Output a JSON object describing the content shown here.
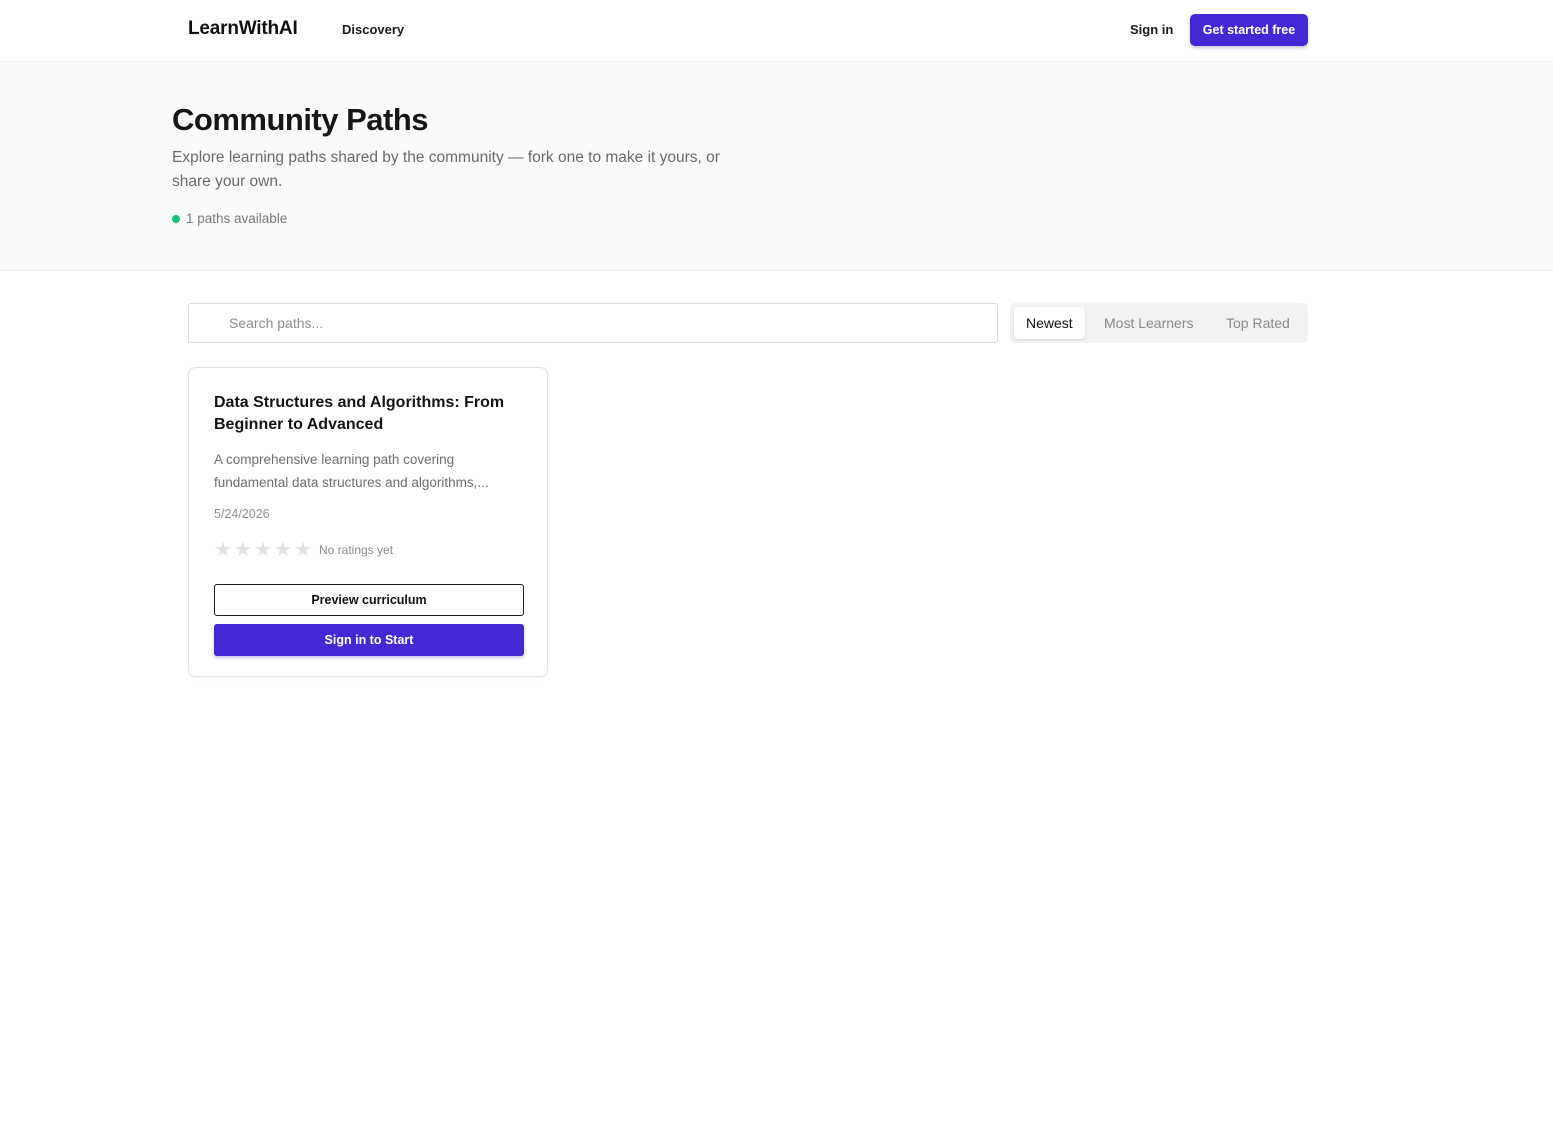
{
  "nav": {
    "brand": "LearnWithAI",
    "links": [
      "Discovery"
    ],
    "signin_label": "Sign in",
    "cta_label": "Get started free"
  },
  "hero": {
    "title": "Community Paths",
    "subtitle": "Explore learning paths shared by the community — fork one to make it yours, or share your own.",
    "status_text": "1 paths available",
    "status_color": "#16c27a"
  },
  "search": {
    "placeholder": "Search paths...",
    "value": ""
  },
  "sort": {
    "options": [
      "Newest",
      "Most Learners",
      "Top Rated"
    ],
    "selected": "Newest"
  },
  "paths": [
    {
      "title": "Data Structures and Algorithms: From Beginner to Advanced",
      "description": "A comprehensive learning path covering fundamental data structures and algorithms,...",
      "date": "5/24/2026",
      "rating": 0,
      "rating_text": "No ratings yet",
      "preview_label": "Preview curriculum",
      "start_label": "Sign in to Start"
    }
  ],
  "colors": {
    "accent": "#4527d6"
  }
}
